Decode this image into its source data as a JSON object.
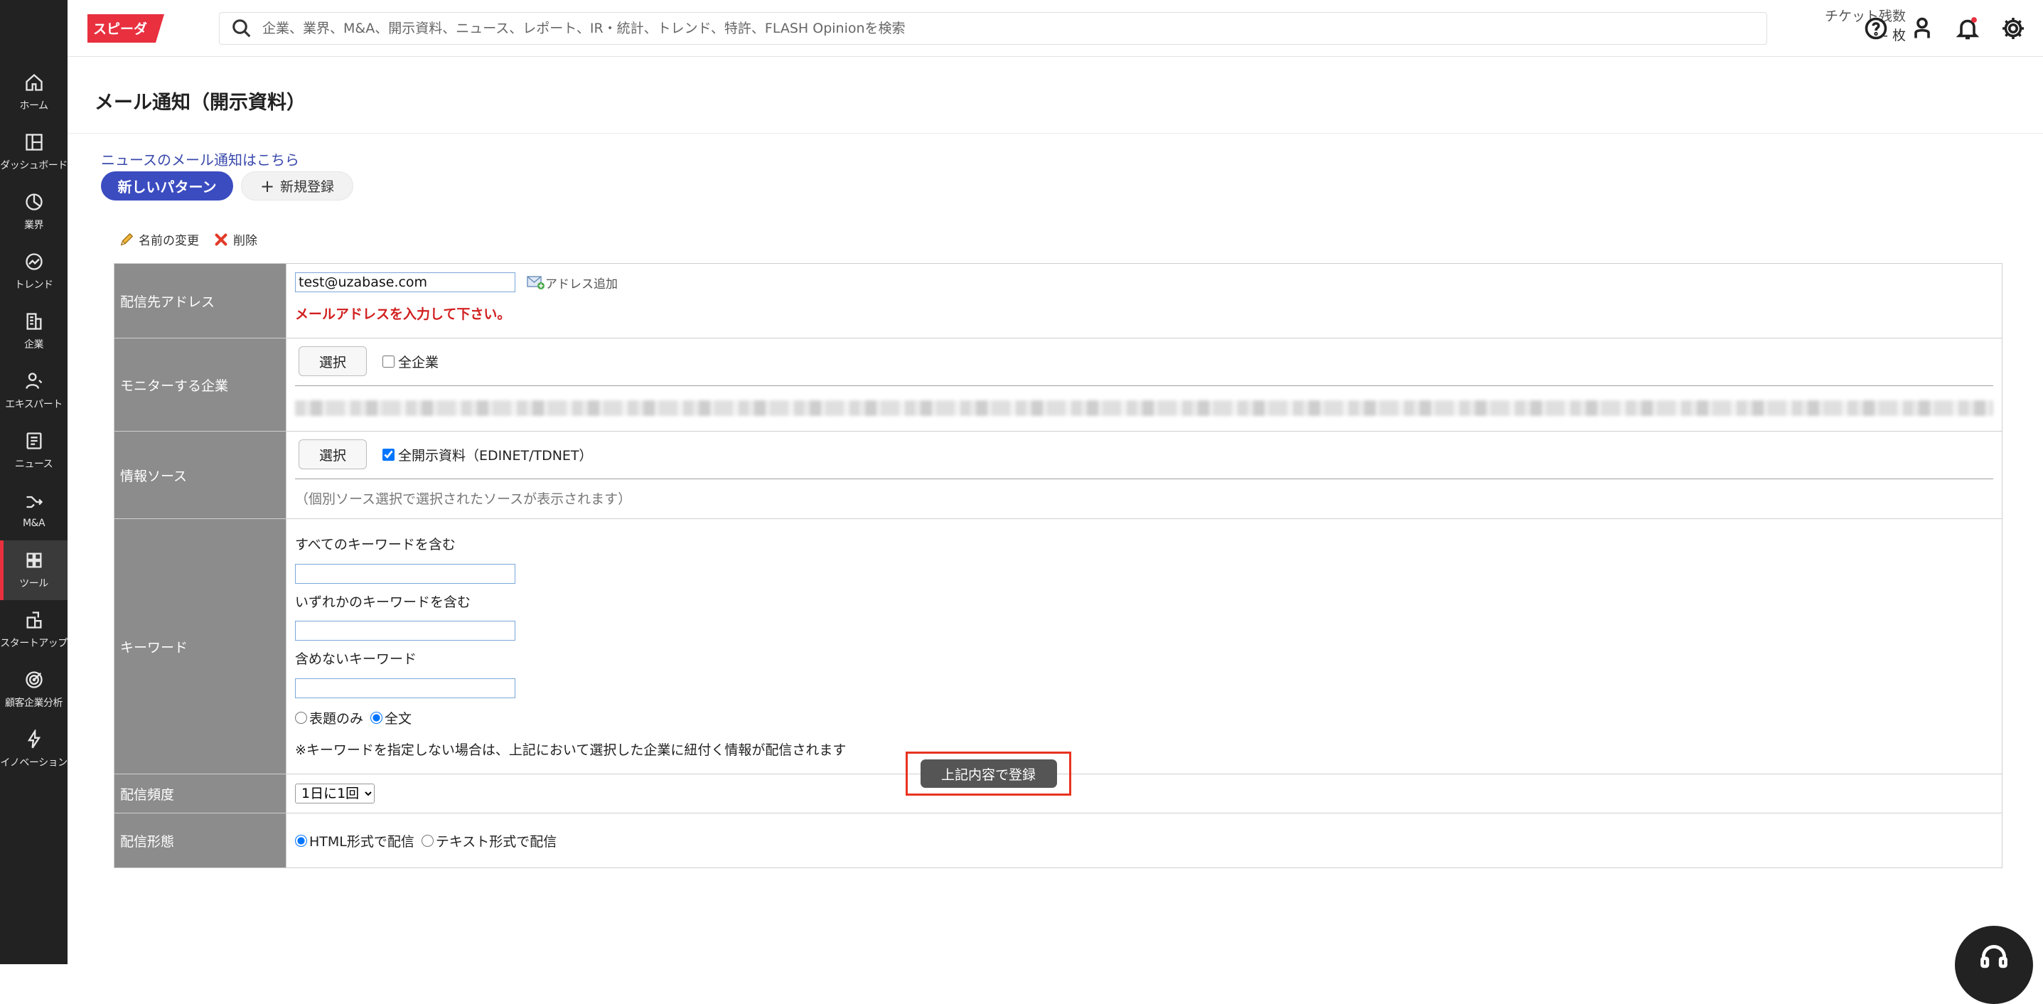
{
  "brand": {
    "logo_text": "スピーダ",
    "color": "#e8303f"
  },
  "header": {
    "search_placeholder": "企業、業界、M&A、開示資料、ニュース、レポート、IR・統計、トレンド、特許、FLASH Opinionを検索",
    "ticket_label": "チケット残数",
    "ticket_count": "- 枚"
  },
  "sidebar": {
    "items": [
      {
        "label": "ホーム",
        "icon": "home-icon"
      },
      {
        "label": "ダッシュボード",
        "icon": "dashboard-icon"
      },
      {
        "label": "業界",
        "icon": "pie-chart-icon"
      },
      {
        "label": "トレンド",
        "icon": "trend-icon"
      },
      {
        "label": "企業",
        "icon": "building-icon"
      },
      {
        "label": "エキスパート",
        "icon": "expert-icon"
      },
      {
        "label": "ニュース",
        "icon": "news-icon"
      },
      {
        "label": "M&A",
        "icon": "merge-icon"
      },
      {
        "label": "ツール",
        "icon": "tools-grid-icon",
        "active": true
      },
      {
        "label": "スタートアップ",
        "icon": "startup-icon"
      },
      {
        "label": "顧客企業分析",
        "icon": "target-icon"
      },
      {
        "label": "イノベーション",
        "icon": "lightning-icon"
      }
    ]
  },
  "page": {
    "title": "メール通知（開示資料）",
    "news_link": "ニュースのメール通知はこちら",
    "pattern_tab": "新しいパターン",
    "new_register": "新規登録",
    "rename": "名前の変更",
    "delete": "削除"
  },
  "form": {
    "address": {
      "label": "配信先アドレス",
      "value": "test@uzabase.com",
      "add_link": "アドレス追加",
      "error": "メールアドレスを入力して下さい。"
    },
    "monitor": {
      "label": "モニターする企業",
      "select_btn": "選択",
      "all_companies": "全企業"
    },
    "source": {
      "label": "情報ソース",
      "select_btn": "選択",
      "all_disclosure": "全開示資料（EDINET/TDNET）",
      "note": "（個別ソース選択で選択されたソースが表示されます）"
    },
    "keyword": {
      "label": "キーワード",
      "all_label": "すべてのキーワードを含む",
      "any_label": "いずれかのキーワードを含む",
      "none_label": "含めないキーワード",
      "title_only": "表題のみ",
      "full_text": "全文",
      "note": "※キーワードを指定しない場合は、上記において選択した企業に紐付く情報が配信されます"
    },
    "frequency": {
      "label": "配信頻度",
      "selected": "1日に1回"
    },
    "format": {
      "label": "配信形態",
      "html": "HTML形式で配信",
      "text": "テキスト形式で配信"
    }
  },
  "submit_label": "上記内容で登録",
  "colors": {
    "accent": "#3b4cc0",
    "highlight": "#e8331f",
    "label_bg": "#8c8c8c"
  }
}
